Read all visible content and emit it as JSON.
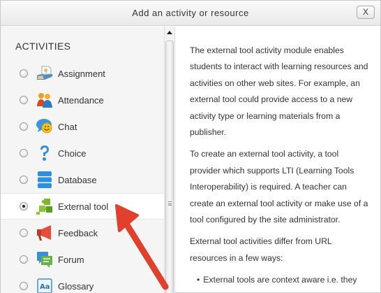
{
  "dialog": {
    "title": "Add an activity or resource",
    "close_label": "X"
  },
  "activities": {
    "heading": "ACTIVITIES",
    "items": [
      {
        "label": "Assignment",
        "icon": "assignment-icon",
        "selected": false
      },
      {
        "label": "Attendance",
        "icon": "attendance-icon",
        "selected": false
      },
      {
        "label": "Chat",
        "icon": "chat-icon",
        "selected": false
      },
      {
        "label": "Choice",
        "icon": "choice-icon",
        "selected": false
      },
      {
        "label": "Database",
        "icon": "database-icon",
        "selected": false
      },
      {
        "label": "External tool",
        "icon": "external-tool-icon",
        "selected": true
      },
      {
        "label": "Feedback",
        "icon": "feedback-icon",
        "selected": false
      },
      {
        "label": "Forum",
        "icon": "forum-icon",
        "selected": false
      },
      {
        "label": "Glossary",
        "icon": "glossary-icon",
        "selected": false
      }
    ]
  },
  "description": {
    "paragraphs": [
      "The external tool activity module enables students to interact with learning resources and activities on other web sites. For example, an external tool could provide access to a new activity type or learning materials from a publisher.",
      "To create an external tool activity, a tool provider which supports LTI (Learning Tools Interoperability) is required. A teacher can create an external tool activity or make use of a tool configured by the site administrator.",
      "External tool activities differ from URL resources in a few ways:"
    ],
    "bullets": [
      "External tools are context aware i.e. they"
    ]
  },
  "colors": {
    "arrow": "#e0402c",
    "selected_row": "#ffffff",
    "list_background": "#f5f5f5"
  }
}
